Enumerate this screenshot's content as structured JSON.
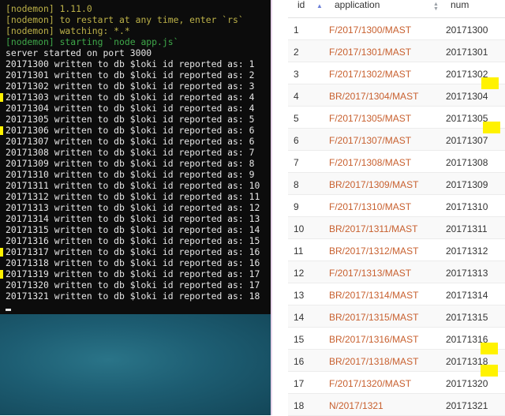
{
  "terminal": {
    "lines": [
      {
        "text": "[nodemon] 1.11.0",
        "kind": "nodemon"
      },
      {
        "text": "[nodemon] to restart at any time, enter `rs`",
        "kind": "nodemon"
      },
      {
        "text": "[nodemon] watching: *.*",
        "kind": "nodemon"
      },
      {
        "text": "[nodemon] starting `node app.js`",
        "kind": "start"
      },
      {
        "text": "server started on port 3000",
        "kind": "out"
      },
      {
        "text": "20171300 written to db $loki id reported as: 1",
        "kind": "out"
      },
      {
        "text": "20171301 written to db $loki id reported as: 2",
        "kind": "out"
      },
      {
        "text": "20171302 written to db $loki id reported as: 3",
        "kind": "out"
      },
      {
        "text": "20171303 written to db $loki id reported as: 4",
        "kind": "out"
      },
      {
        "text": "20171304 written to db $loki id reported as: 4",
        "kind": "out"
      },
      {
        "text": "20171305 written to db $loki id reported as: 5",
        "kind": "out"
      },
      {
        "text": "20171306 written to db $loki id reported as: 6",
        "kind": "out"
      },
      {
        "text": "20171307 written to db $loki id reported as: 6",
        "kind": "out"
      },
      {
        "text": "20171308 written to db $loki id reported as: 7",
        "kind": "out"
      },
      {
        "text": "20171309 written to db $loki id reported as: 8",
        "kind": "out"
      },
      {
        "text": "20171310 written to db $loki id reported as: 9",
        "kind": "out"
      },
      {
        "text": "20171311 written to db $loki id reported as: 10",
        "kind": "out"
      },
      {
        "text": "20171312 written to db $loki id reported as: 11",
        "kind": "out"
      },
      {
        "text": "20171313 written to db $loki id reported as: 12",
        "kind": "out"
      },
      {
        "text": "20171314 written to db $loki id reported as: 13",
        "kind": "out"
      },
      {
        "text": "20171315 written to db $loki id reported as: 14",
        "kind": "out"
      },
      {
        "text": "20171316 written to db $loki id reported as: 15",
        "kind": "out"
      },
      {
        "text": "20171317 written to db $loki id reported as: 16",
        "kind": "out"
      },
      {
        "text": "20171318 written to db $loki id reported as: 16",
        "kind": "out"
      },
      {
        "text": "20171319 written to db $loki id reported as: 17",
        "kind": "out"
      },
      {
        "text": "20171320 written to db $loki id reported as: 17",
        "kind": "out"
      },
      {
        "text": "20171321 written to db $loki id reported as: 18",
        "kind": "out"
      }
    ]
  },
  "table": {
    "columns": [
      {
        "label": "id",
        "sort": "ascending"
      },
      {
        "label": "application",
        "sort": "unsorted"
      },
      {
        "label": "num",
        "sort": "none"
      }
    ],
    "rows": [
      {
        "id": "1",
        "application": "F/2017/1300/MAST",
        "num": "20171300"
      },
      {
        "id": "2",
        "application": "F/2017/1301/MAST",
        "num": "20171301"
      },
      {
        "id": "3",
        "application": "F/2017/1302/MAST",
        "num": "20171302"
      },
      {
        "id": "4",
        "application": "BR/2017/1304/MAST",
        "num": "20171304"
      },
      {
        "id": "5",
        "application": "F/2017/1305/MAST",
        "num": "20171305"
      },
      {
        "id": "6",
        "application": "F/2017/1307/MAST",
        "num": "20171307"
      },
      {
        "id": "7",
        "application": "F/2017/1308/MAST",
        "num": "20171308"
      },
      {
        "id": "8",
        "application": "BR/2017/1309/MAST",
        "num": "20171309"
      },
      {
        "id": "9",
        "application": "F/2017/1310/MAST",
        "num": "20171310"
      },
      {
        "id": "10",
        "application": "BR/2017/1311/MAST",
        "num": "20171311"
      },
      {
        "id": "11",
        "application": "BR/2017/1312/MAST",
        "num": "20171312"
      },
      {
        "id": "12",
        "application": "F/2017/1313/MAST",
        "num": "20171313"
      },
      {
        "id": "13",
        "application": "BR/2017/1314/MAST",
        "num": "20171314"
      },
      {
        "id": "14",
        "application": "BR/2017/1315/MAST",
        "num": "20171315"
      },
      {
        "id": "15",
        "application": "BR/2017/1316/MAST",
        "num": "20171316"
      },
      {
        "id": "16",
        "application": "BR/2017/1318/MAST",
        "num": "20171318"
      },
      {
        "id": "17",
        "application": "F/2017/1320/MAST",
        "num": "20171320"
      },
      {
        "id": "18",
        "application": "N/2017/1321",
        "num": "20171321"
      }
    ]
  },
  "colors": {
    "terminal_bg": "#0c0c0c",
    "terminal_text": "#e6e6e6",
    "nodemon_text": "#bcb148",
    "start_text": "#3fa84a",
    "application_link": "#c8602f",
    "highlight": "#fff200"
  },
  "icons": {
    "id_sort": "sort-up-icon",
    "application_sort": "sort-both-icon"
  }
}
